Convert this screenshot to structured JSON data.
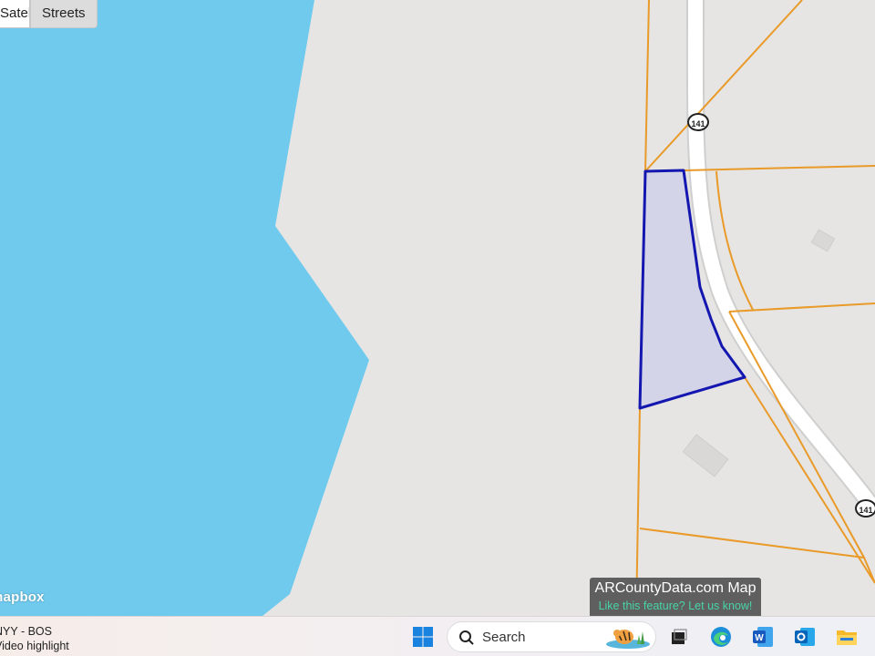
{
  "map": {
    "layer_buttons": [
      "Satellite",
      "Streets"
    ],
    "active_layer": "Streets",
    "logo_text": "mapbox",
    "route_shields": [
      "141",
      "141"
    ],
    "colors": {
      "land": "#e6e5e3",
      "water": "#6fcaee",
      "road": "#ffffff",
      "road_edge": "#c9c9c9",
      "parcel_line": "#e99a28",
      "selected_parcel_stroke": "#1416b0",
      "selected_parcel_fill": "#d1d1e8",
      "building": "#d8d7d5"
    }
  },
  "attribution": {
    "title": "ARCountyData.com Map",
    "link": "Like this feature? Let us know!"
  },
  "taskbar": {
    "widget_line1": "NYY - BOS",
    "widget_line2": "Video highlight",
    "search_label": "Search",
    "icons": [
      "windows-start",
      "search",
      "widgets-tiger",
      "task-view",
      "edge",
      "word",
      "outlook",
      "file-explorer"
    ]
  }
}
